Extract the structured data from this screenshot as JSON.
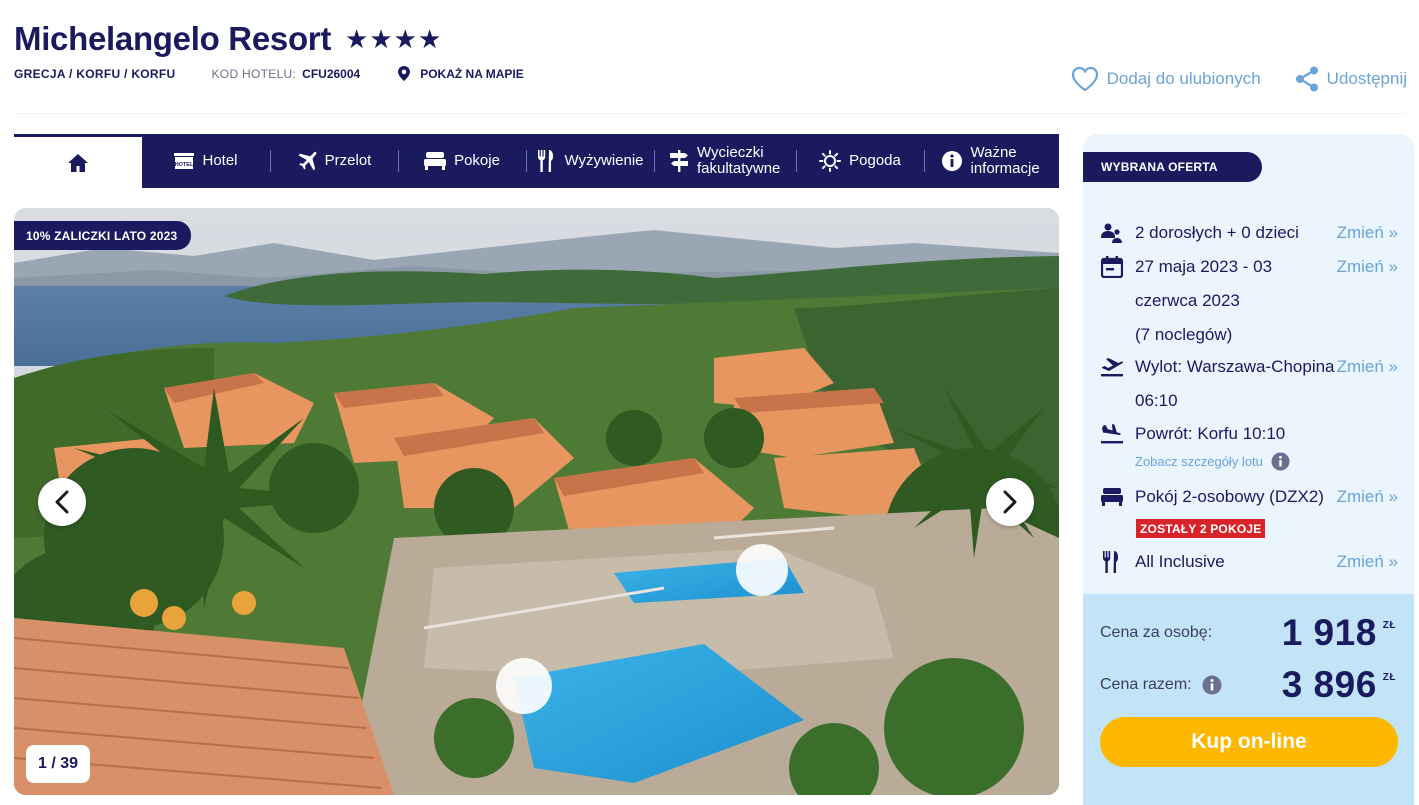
{
  "hotel": {
    "name": "Michelangelo Resort",
    "stars": "★★★★",
    "location": "GRECJA / KORFU / KORFU",
    "code_label": "KOD HOTELU:",
    "code_value": "CFU26004",
    "map_link": "POKAŻ NA MAPIE"
  },
  "actions": {
    "favorite": "Dodaj do ulubionych",
    "share": "Udostępnij"
  },
  "tabs": [
    {
      "label": "",
      "icon": "home-icon"
    },
    {
      "label": "Hotel",
      "icon": "hotel-icon"
    },
    {
      "label": "Przelot",
      "icon": "plane-icon"
    },
    {
      "label": "Pokoje",
      "icon": "bed-icon"
    },
    {
      "label": "Wyżywienie",
      "icon": "fork-knife-icon"
    },
    {
      "label": "Wycieczki fakultatywne",
      "icon": "signpost-icon"
    },
    {
      "label": "Pogoda",
      "icon": "sun-icon"
    },
    {
      "label": "Ważne informacje",
      "icon": "info-icon"
    }
  ],
  "gallery": {
    "badge": "10% ZALICZKI LATO 2023",
    "counter": "1 / 39"
  },
  "offer": {
    "badge": "WYBRANA OFERTA",
    "change_label": "Zmień »",
    "travelers": "2 dorosłych + 0 dzieci",
    "dates_line1": "27 maja 2023 - 03",
    "dates_line2": "czerwca 2023",
    "dates_line3": "(7 noclegów)",
    "departure_line1": "Wylot: Warszawa-Chopina",
    "departure_line2": "06:10",
    "return": "Powrót: Korfu 10:10",
    "flight_details": "Zobacz szczegóły lotu",
    "room": "Pokój 2-osobowy (DZX2)",
    "rooms_left": "ZOSTAŁY 2 POKOJE",
    "board": "All Inclusive"
  },
  "price": {
    "per_person_label": "Cena za osobę:",
    "per_person_value": "1 918",
    "total_label": "Cena razem:",
    "total_value": "3 896",
    "currency": "ZŁ",
    "buy_button": "Kup on-line"
  },
  "colors": {
    "navy": "#1a1a5e",
    "link_blue": "#6aa4d8",
    "panel_bg": "#eaf5fd",
    "price_bg": "#c3e3f7",
    "buy_yellow": "#ffb800",
    "alert_red": "#d8232a"
  }
}
